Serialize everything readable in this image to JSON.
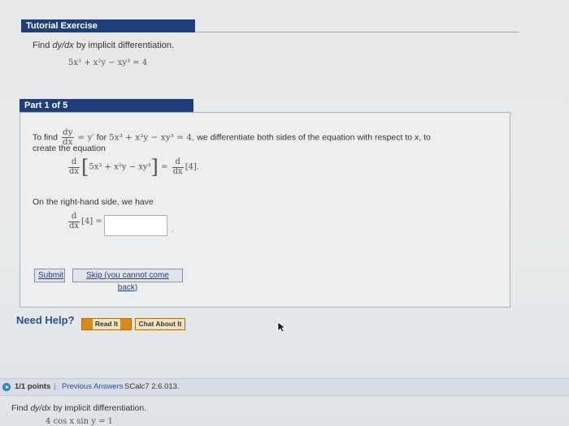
{
  "tutorial": {
    "header": "Tutorial Exercise",
    "problem_prefix": "Find ",
    "problem_dydx": "dy/dx",
    "problem_suffix": " by implicit differentiation.",
    "equation": "5x³ + x²y − xy³ = 4"
  },
  "part": {
    "header": "Part 1 of 5",
    "intro_prefix": "To find",
    "frac_num": "dy",
    "frac_den": "dx",
    "equals_yprime": "= y′",
    "for_word": " for ",
    "equation": "5x³ + x²y − xy³ = 4,",
    "intro_suffix": " we differentiate both sides of the equation with respect to ",
    "var_x": "x",
    "intro_tail": ", to",
    "create_line": "create the equation",
    "deriv_num": "d",
    "deriv_den": "dx",
    "deriv_inner": "5x³ + x²y − xy³",
    "deriv_equals": "=",
    "deriv_rhs": "[4].",
    "rhs_text": "On the right-hand side, we have",
    "rhs_expr": "[4] =",
    "trailing": "."
  },
  "buttons": {
    "submit": "Submit",
    "skip": "Skip (you cannot come back)"
  },
  "help": {
    "label": "Need Help?",
    "read": "Read It",
    "chat": "Chat About It"
  },
  "next_problem": {
    "points": "1/1 points",
    "separator": "|",
    "previous_answers": "Previous Answers",
    "code": "SCalc7 2.6.013.",
    "problem_prefix": "Find ",
    "problem_dydx": "dy/dx",
    "problem_suffix": " by implicit differentiation.",
    "equation": "4 cos x sin y = 1"
  },
  "colors": {
    "header_bg": "#1f3e7a",
    "help_text": "#2d4f8c",
    "help_button": "#d8891e",
    "page_bg": "#e9ebec"
  }
}
